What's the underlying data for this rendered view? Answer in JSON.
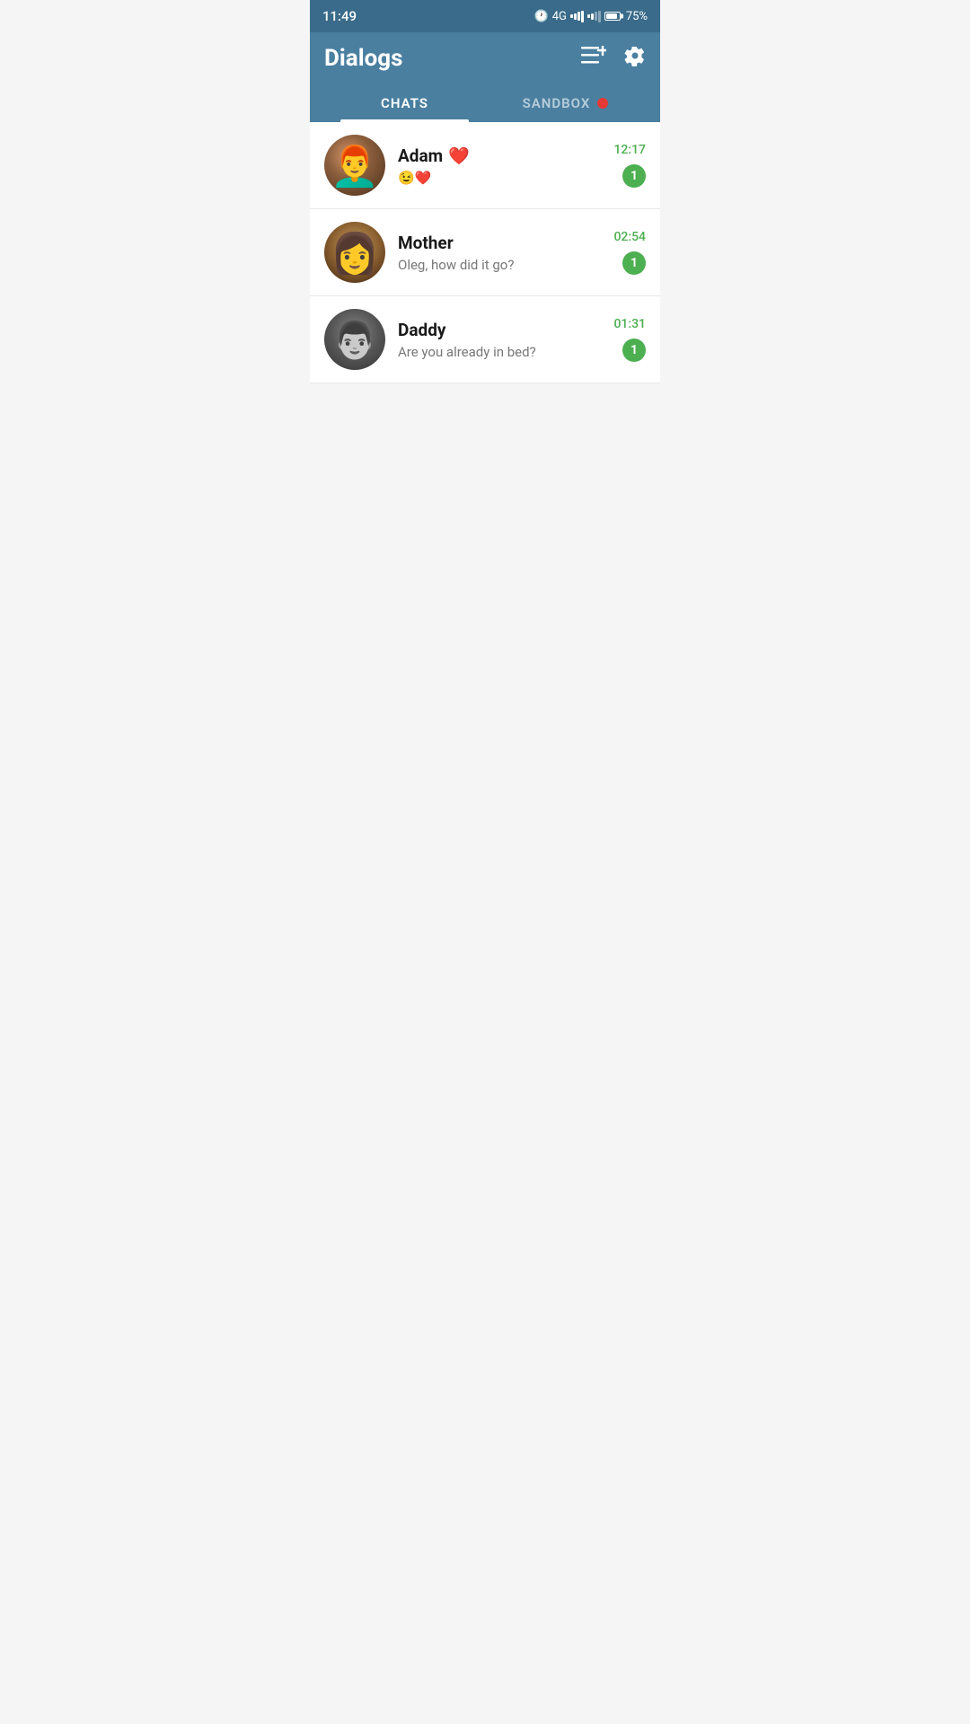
{
  "statusBar": {
    "time": "11:49",
    "network": "4G",
    "battery": "75%"
  },
  "header": {
    "title": "Dialogs",
    "newChatIcon": "≡+",
    "settingsIcon": "⚙"
  },
  "tabs": [
    {
      "id": "chats",
      "label": "CHATS",
      "active": true
    },
    {
      "id": "sandbox",
      "label": "SANDBOX",
      "active": false,
      "hasDot": true
    }
  ],
  "chats": [
    {
      "id": "adam",
      "name": "Adam",
      "nameEmoji": "❤️",
      "preview": "😉❤️",
      "previewIsEmoji": true,
      "time": "12:17",
      "unread": "1",
      "avatarClass": "avatar-adam"
    },
    {
      "id": "mother",
      "name": "Mother",
      "preview": "Oleg, how did it go?",
      "time": "02:54",
      "unread": "1",
      "avatarClass": "avatar-mother"
    },
    {
      "id": "daddy",
      "name": "Daddy",
      "preview": "Are you already in bed?",
      "time": "01:31",
      "unread": "1",
      "avatarClass": "avatar-daddy"
    }
  ]
}
